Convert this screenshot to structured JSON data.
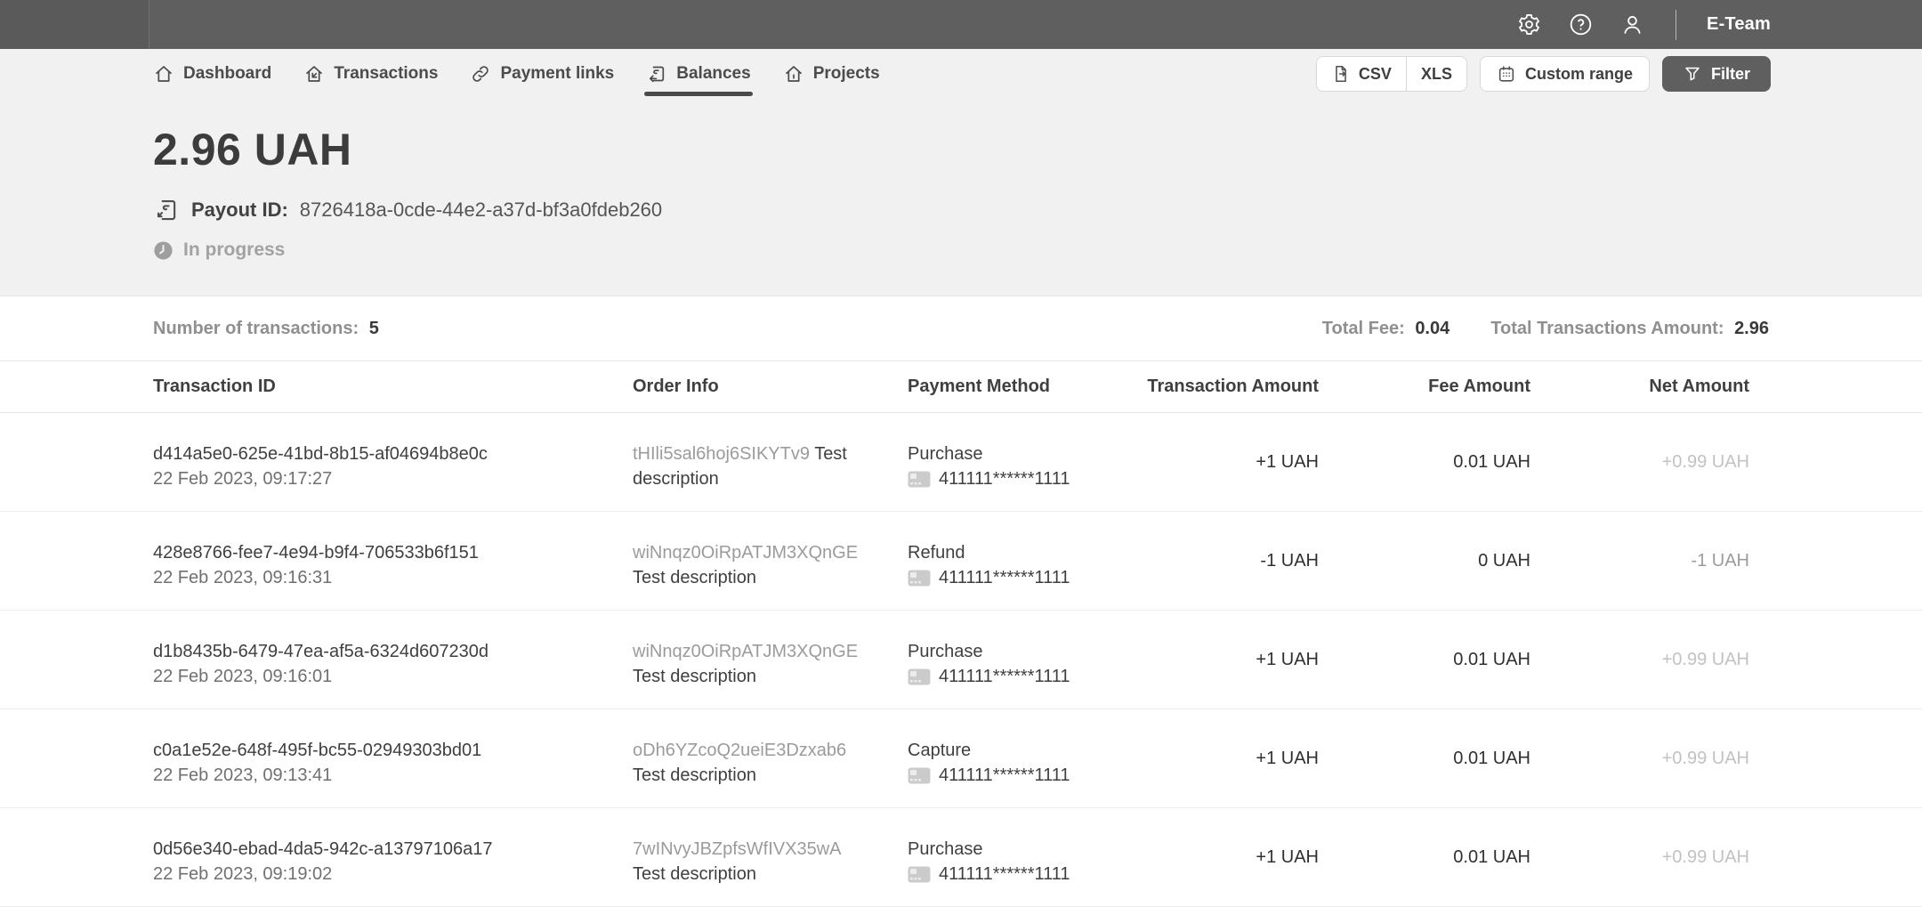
{
  "topbar": {
    "team_name": "E-Team",
    "icons": [
      "settings-gear-icon",
      "help-icon",
      "user-icon"
    ]
  },
  "nav": {
    "tabs": [
      {
        "label": "Dashboard",
        "icon": "home-icon",
        "active": false
      },
      {
        "label": "Transactions",
        "icon": "transactions-icon",
        "active": false
      },
      {
        "label": "Payment links",
        "icon": "link-icon",
        "active": false
      },
      {
        "label": "Balances",
        "icon": "balances-card-icon",
        "active": true
      },
      {
        "label": "Projects",
        "icon": "projects-icon",
        "active": false
      }
    ]
  },
  "toolbar": {
    "csv_label": "CSV",
    "xls_label": "XLS",
    "custom_range_label": "Custom range",
    "filter_label": "Filter"
  },
  "payout": {
    "amount": "2.96 UAH",
    "id_label": "Payout ID:",
    "id_value": "8726418a-0cde-44e2-a37d-bf3a0fdeb260",
    "status": "In progress"
  },
  "summary": {
    "transactions_label": "Number of transactions:",
    "transactions_value": "5",
    "total_fee_label": "Total Fee:",
    "total_fee_value": "0.04",
    "total_amount_label": "Total Transactions Amount:",
    "total_amount_value": "2.96"
  },
  "table": {
    "headers": [
      "Transaction ID",
      "Order Info",
      "Payment Method",
      "Transaction Amount",
      "Fee Amount",
      "Net Amount"
    ],
    "rows": [
      {
        "transaction_id": "d414a5e0-625e-41bd-8b15-af04694b8e0c",
        "datetime": "22 Feb 2023, 09:17:27",
        "order_id": "tHIli5sal6hoj6SIKYTv9",
        "order_description": "Test description",
        "method_type": "Purchase",
        "card_number": "411111******1111",
        "transaction_amount": "+1 UAH",
        "fee_amount": "0.01 UAH",
        "net_amount": "+0.99 UAH",
        "net_style": "muted"
      },
      {
        "transaction_id": "428e8766-fee7-4e94-b9f4-706533b6f151",
        "datetime": "22 Feb 2023, 09:16:31",
        "order_id": "wiNnqz0OiRpATJM3XQnGE",
        "order_description": "Test description",
        "method_type": "Refund",
        "card_number": "411111******1111",
        "transaction_amount": "-1 UAH",
        "fee_amount": "0 UAH",
        "net_amount": "-1 UAH",
        "net_style": "mid"
      },
      {
        "transaction_id": "d1b8435b-6479-47ea-af5a-6324d607230d",
        "datetime": "22 Feb 2023, 09:16:01",
        "order_id": "wiNnqz0OiRpATJM3XQnGE",
        "order_description": "Test description",
        "method_type": "Purchase",
        "card_number": "411111******1111",
        "transaction_amount": "+1 UAH",
        "fee_amount": "0.01 UAH",
        "net_amount": "+0.99 UAH",
        "net_style": "muted"
      },
      {
        "transaction_id": "c0a1e52e-648f-495f-bc55-02949303bd01",
        "datetime": "22 Feb 2023, 09:13:41",
        "order_id": "oDh6YZcoQ2ueiE3Dzxab6",
        "order_description": "Test description",
        "method_type": "Capture",
        "card_number": "411111******1111",
        "transaction_amount": "+1 UAH",
        "fee_amount": "0.01 UAH",
        "net_amount": "+0.99 UAH",
        "net_style": "muted"
      },
      {
        "transaction_id": "0d56e340-ebad-4da5-942c-a13797106a17",
        "datetime": "22 Feb 2023, 09:19:02",
        "order_id": "7wINvyJBZpfsWfIVX35wA",
        "order_description": "Test description",
        "method_type": "Purchase",
        "card_number": "411111******1111",
        "transaction_amount": "+1 UAH",
        "fee_amount": "0.01 UAH",
        "net_amount": "+0.99 UAH",
        "net_style": "muted"
      }
    ]
  },
  "colors": {
    "topbar_bg": "#5f5f5f",
    "header_bg": "#f1f1f1",
    "filter_button_bg": "#5f5f5f",
    "active_tab_underline": "#4a4a4a",
    "muted_amount": "#c2c2c2",
    "border": "#e6e6e6"
  }
}
